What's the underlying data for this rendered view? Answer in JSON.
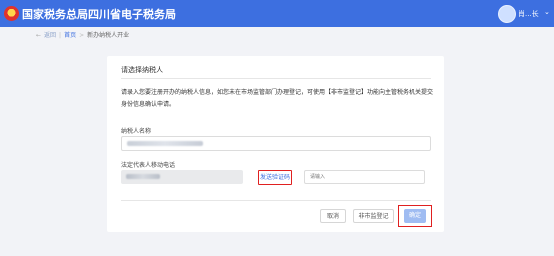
{
  "header": {
    "title": "国家税务总局四川省电子税务局",
    "user_name": "肖...长",
    "caret": "⌄"
  },
  "breadcrumb": {
    "back": "返回",
    "home": "首页",
    "current": "新办纳税人开业"
  },
  "card": {
    "title": "请选择纳税人",
    "notice": "请录入您要注册开办的纳税人信息，如您未在市场监管部门办理登记，可使用【非市监登记】功能向主管税务机关提交身份信息确认申请。",
    "taxpayer_label": "纳税人名称",
    "phone_label": "法定代表人移动电话",
    "send_code": "发送验证码",
    "code_placeholder": "请输入"
  },
  "actions": {
    "cancel": "取消",
    "non_market": "非市监登记",
    "confirm": "确定"
  }
}
